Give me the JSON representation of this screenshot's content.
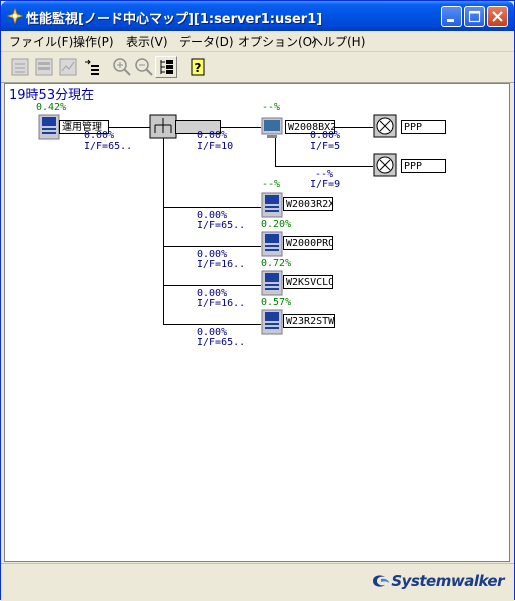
{
  "window": {
    "title": "性能監視[ノード中心マップ][1:server1:user1]"
  },
  "menu": [
    "ファイル(F)",
    "操作(P)",
    "表示(V)",
    "データ(D)",
    "オプション(O)",
    "ヘルプ(H)"
  ],
  "toolbar_icons": [
    "node-view-icon",
    "list-view-icon",
    "graph-view-icon",
    "tree-arrow-icon",
    "zoom-in-icon",
    "zoom-out-icon",
    "hierarchy-icon",
    "help-icon"
  ],
  "timestamp": "19時53分現在",
  "map": {
    "root": {
      "load": "0.42%",
      "name": "運用管理"
    },
    "hub": {
      "name": ""
    },
    "link_root_hub": {
      "load": "0.00%",
      "iface": "I/F=65.."
    },
    "link_hub_w2008": {
      "load": "0.00%",
      "iface": "I/F=10"
    },
    "w2008": {
      "load": "--%",
      "name": "W2008BX2"
    },
    "ppp1": {
      "name": "PPP",
      "link_load": "0.00%",
      "link_iface": "I/F=5"
    },
    "ppp2": {
      "name": "PPP",
      "link_load": "--%",
      "link_iface": "I/F=9"
    },
    "children": [
      {
        "load": "--%",
        "name": "W2003R2X",
        "link_load": "0.00%",
        "link_iface": "I/F=65.."
      },
      {
        "load": "0.20%",
        "name": "W2000PRO",
        "link_load": "0.00%",
        "link_iface": "I/F=16.."
      },
      {
        "load": "0.72%",
        "name": "W2KSVCLO",
        "link_load": "0.00%",
        "link_iface": "I/F=16.."
      },
      {
        "load": "0.57%",
        "name": "W23R2STW",
        "link_load": "0.00%",
        "link_iface": "I/F=65.."
      }
    ]
  },
  "logo": "Systemwalker",
  "colors": {
    "title_bar": "#0054e3",
    "load_text": "#008000",
    "iface_text": "#000080",
    "timestamp": "#0000aa"
  }
}
